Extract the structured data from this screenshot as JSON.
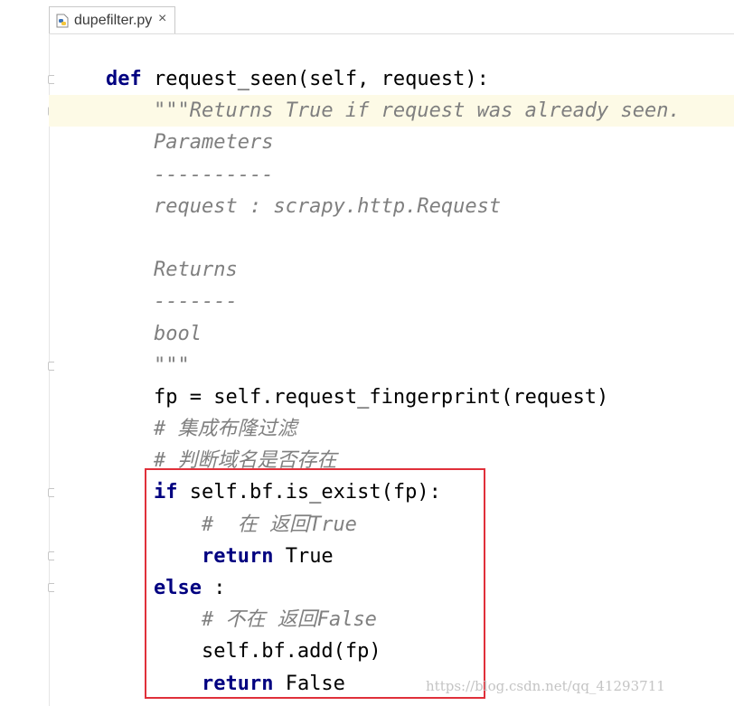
{
  "tab": {
    "filename": "dupefilter.py",
    "close_glyph": "×",
    "icon": "python-file-icon"
  },
  "code_lines": [
    {
      "indent": "",
      "parts": [
        {
          "t": "def",
          "c": "kw"
        },
        {
          "t": " request_seen(self, request):",
          "c": ""
        }
      ]
    },
    {
      "indent": "    ",
      "highlight": true,
      "parts": [
        {
          "t": "\"\"\"Returns True if request was already seen.",
          "c": "doc"
        }
      ]
    },
    {
      "indent": "    ",
      "parts": [
        {
          "t": "Parameters",
          "c": "doc"
        }
      ]
    },
    {
      "indent": "    ",
      "parts": [
        {
          "t": "----------",
          "c": "doc"
        }
      ]
    },
    {
      "indent": "    ",
      "parts": [
        {
          "t": "request : scrapy.http.Request",
          "c": "doc"
        }
      ]
    },
    {
      "indent": "",
      "parts": []
    },
    {
      "indent": "    ",
      "parts": [
        {
          "t": "Returns",
          "c": "doc"
        }
      ]
    },
    {
      "indent": "    ",
      "parts": [
        {
          "t": "-------",
          "c": "doc"
        }
      ]
    },
    {
      "indent": "    ",
      "parts": [
        {
          "t": "bool",
          "c": "doc"
        }
      ]
    },
    {
      "indent": "    ",
      "parts": [
        {
          "t": "\"\"\"",
          "c": "doc"
        }
      ]
    },
    {
      "indent": "    ",
      "parts": [
        {
          "t": "fp = self.request_fingerprint(request)",
          "c": ""
        }
      ]
    },
    {
      "indent": "    ",
      "parts": [
        {
          "t": "# 集成布隆过滤",
          "c": "cm"
        }
      ]
    },
    {
      "indent": "    ",
      "parts": [
        {
          "t": "# 判断域名是否存在",
          "c": "cm"
        }
      ]
    },
    {
      "indent": "    ",
      "parts": [
        {
          "t": "if",
          "c": "kw"
        },
        {
          "t": " self.bf.is_exist(fp):",
          "c": ""
        }
      ]
    },
    {
      "indent": "        ",
      "parts": [
        {
          "t": "#  在 返回True",
          "c": "cm"
        }
      ]
    },
    {
      "indent": "        ",
      "parts": [
        {
          "t": "return",
          "c": "kw"
        },
        {
          "t": " True",
          "c": ""
        }
      ]
    },
    {
      "indent": "    ",
      "parts": [
        {
          "t": "else",
          "c": "kw"
        },
        {
          "t": " :",
          "c": ""
        }
      ]
    },
    {
      "indent": "        ",
      "parts": [
        {
          "t": "# 不在 返回False",
          "c": "cm"
        }
      ]
    },
    {
      "indent": "        ",
      "parts": [
        {
          "t": "self.bf.add(fp)",
          "c": ""
        }
      ]
    },
    {
      "indent": "        ",
      "parts": [
        {
          "t": "return",
          "c": "kw"
        },
        {
          "t": " False",
          "c": ""
        }
      ]
    }
  ],
  "watermark": "https://blog.csdn.net/qq_41293711",
  "colors": {
    "keyword": "#000080",
    "docstring": "#7f7f7f",
    "comment": "#808080",
    "highlight_line": "#fdfae6",
    "annotation_box": "#e0303a"
  }
}
